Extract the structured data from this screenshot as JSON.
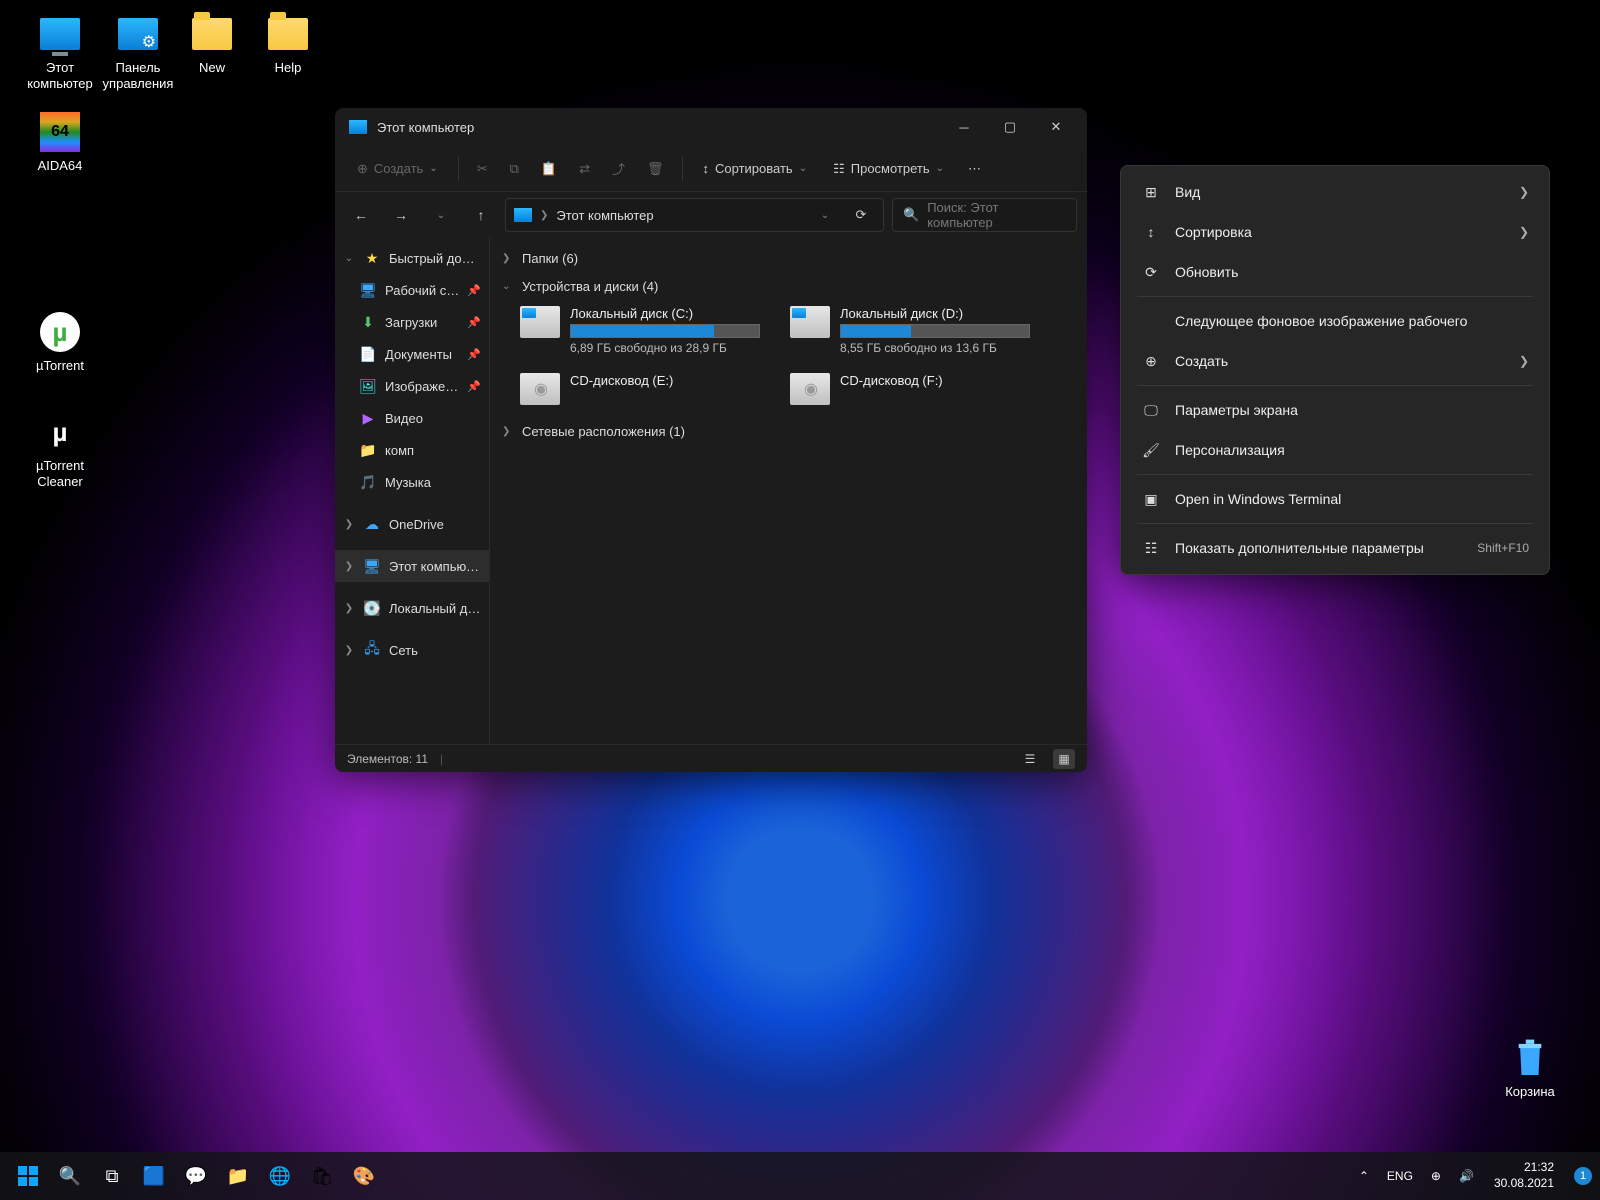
{
  "desktop_icons": {
    "this_pc": "Этот компьютер",
    "control_panel": "Панель управления",
    "new": "New",
    "help": "Help",
    "aida64": "AIDA64",
    "utorrent": "µTorrent",
    "utorrent_cleaner": "µTorrent Cleaner",
    "recycle": "Корзина"
  },
  "explorer": {
    "title": "Этот компьютер",
    "toolbar": {
      "create": "Создать",
      "sort": "Сортировать",
      "view": "Просмотреть"
    },
    "address": "Этот компьютер",
    "search_placeholder": "Поиск: Этот компьютер",
    "sidebar": {
      "quick_access": "Быстрый доступ",
      "desktop": "Рабочий стол",
      "downloads": "Загрузки",
      "documents": "Документы",
      "pictures": "Изображения",
      "videos": "Видео",
      "komp": "комп",
      "music": "Музыка",
      "onedrive": "OneDrive",
      "this_pc": "Этот компьютер",
      "local_disk": "Локальный диск (D",
      "network": "Сеть"
    },
    "groups": {
      "folders": "Папки (6)",
      "devices": "Устройства и диски (4)",
      "network": "Сетевые расположения (1)"
    },
    "drives": {
      "c": {
        "name": "Локальный диск (C:)",
        "free": "6,89 ГБ свободно из 28,9 ГБ",
        "fill_pct": 76
      },
      "d": {
        "name": "Локальный диск (D:)",
        "free": "8,55 ГБ свободно из 13,6 ГБ",
        "fill_pct": 37
      },
      "e": {
        "name": "CD-дисковод (E:)"
      },
      "f": {
        "name": "CD-дисковод (F:)"
      }
    },
    "status": "Элементов: 11"
  },
  "context_menu": {
    "view": "Вид",
    "sort": "Сортировка",
    "refresh": "Обновить",
    "next_bg": "Следующее фоновое изображение рабочего",
    "create": "Создать",
    "display": "Параметры экрана",
    "personalize": "Персонализация",
    "terminal": "Open in Windows Terminal",
    "more": "Показать дополнительные параметры",
    "more_shortcut": "Shift+F10"
  },
  "taskbar": {
    "lang": "ENG",
    "time": "21:32",
    "date": "30.08.2021",
    "notif_count": "1"
  }
}
